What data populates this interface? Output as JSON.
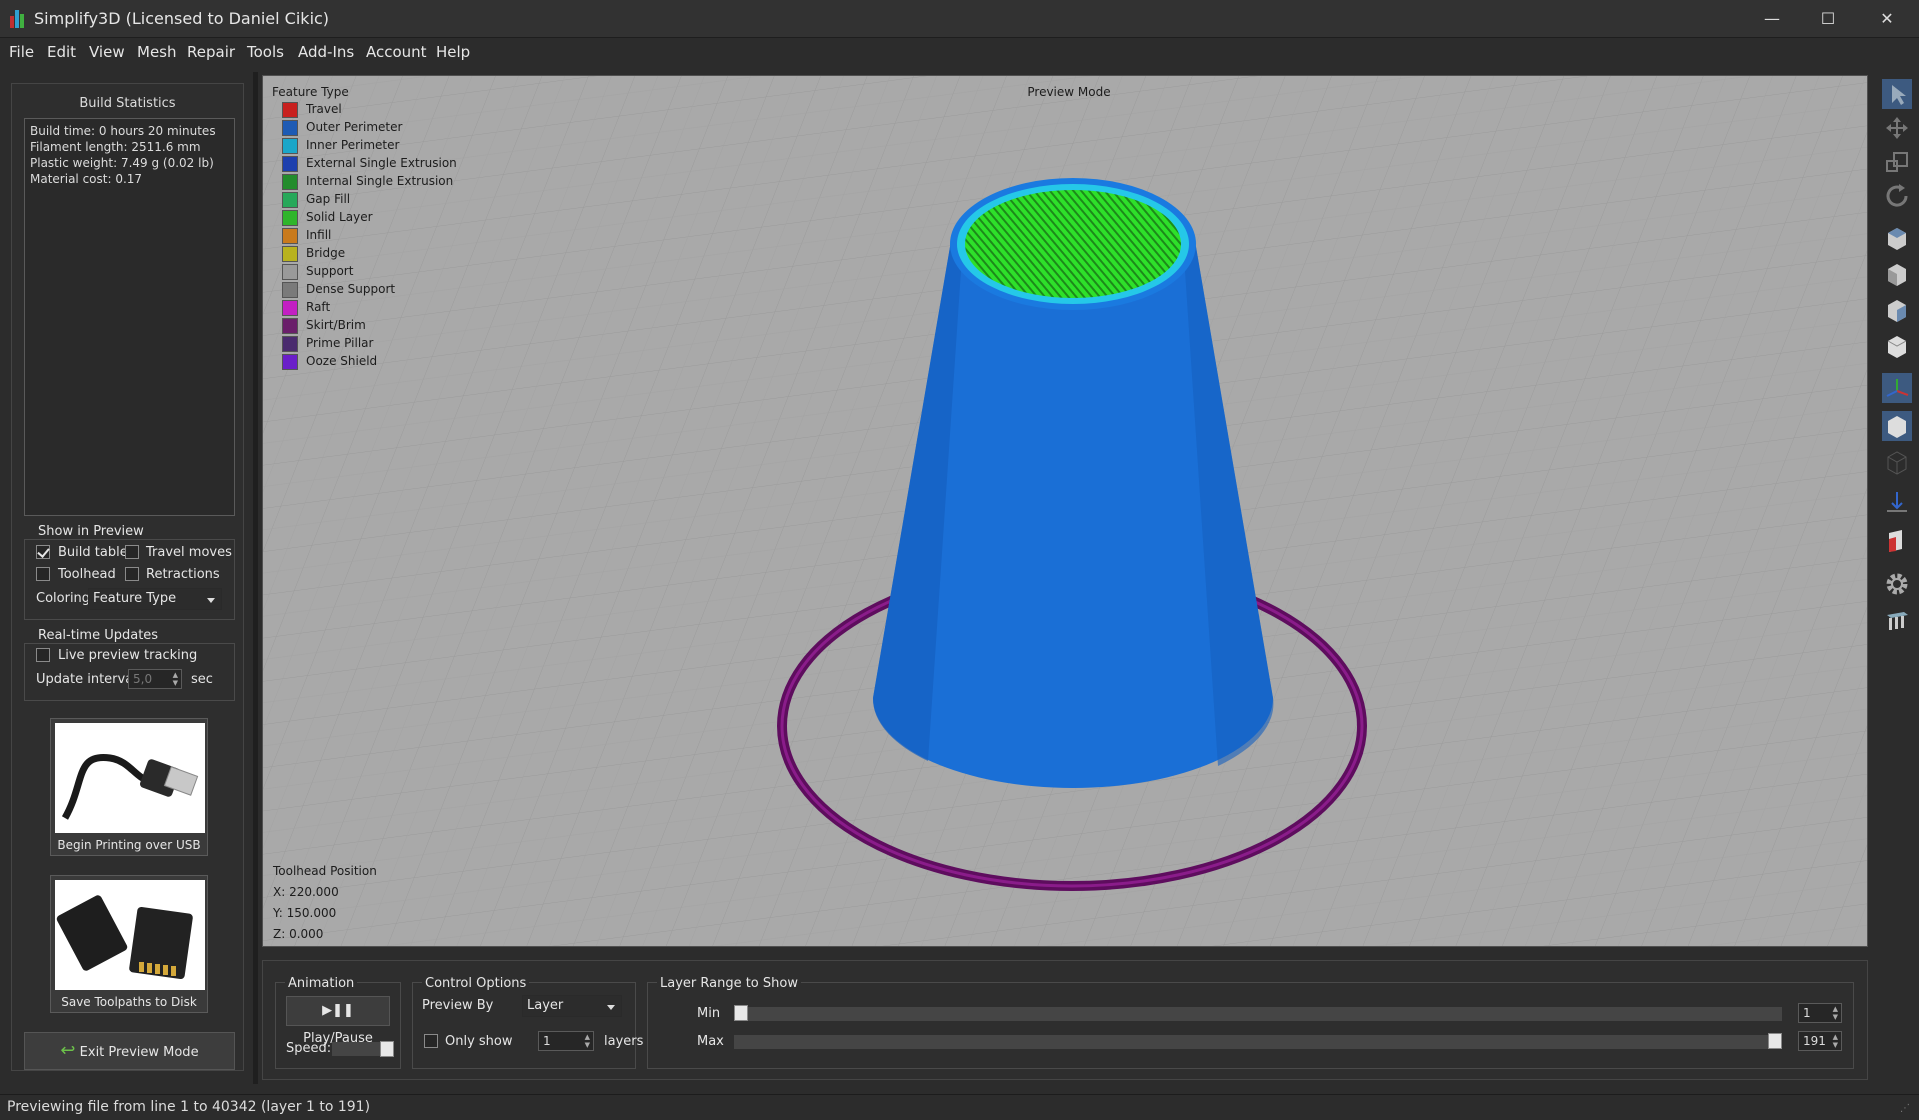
{
  "window": {
    "title": "Simplify3D (Licensed to Daniel Cikic)",
    "minimize": "—",
    "maximize": "☐",
    "close": "✕"
  },
  "menu": [
    "File",
    "Edit",
    "View",
    "Mesh",
    "Repair",
    "Tools",
    "Add-Ins",
    "Account",
    "Help"
  ],
  "build_stats": {
    "title": "Build Statistics",
    "lines": [
      "Build time: 0 hours 20 minutes",
      "Filament length: 2511.6 mm",
      "Plastic weight: 7.49 g (0.02 lb)",
      "Material cost: 0.17"
    ]
  },
  "show_in_preview": {
    "title": "Show in Preview",
    "build_table": {
      "label": "Build table",
      "checked": true
    },
    "travel_moves": {
      "label": "Travel moves",
      "checked": false
    },
    "toolhead": {
      "label": "Toolhead",
      "checked": false
    },
    "retractions": {
      "label": "Retractions",
      "checked": false
    },
    "coloring_label": "Coloring",
    "coloring_value": "Feature Type"
  },
  "realtime": {
    "title": "Real-time Updates",
    "live_label": "Live preview tracking",
    "interval_label": "Update interval",
    "interval_value": "5,0",
    "interval_unit": "sec"
  },
  "usb_button": {
    "label": "Begin Printing over USB"
  },
  "sd_button": {
    "label": "Save Toolpaths to Disk"
  },
  "exit_button": {
    "label": "Exit Preview Mode"
  },
  "viewport": {
    "mode_label": "Preview Mode",
    "legend_title": "Feature Type",
    "legend": [
      {
        "name": "Travel",
        "color": "#c8201e"
      },
      {
        "name": "Outer Perimeter",
        "color": "#1e5bb4"
      },
      {
        "name": "Inner Perimeter",
        "color": "#1aa6c9"
      },
      {
        "name": "External Single Extrusion",
        "color": "#1c3fae"
      },
      {
        "name": "Internal Single Extrusion",
        "color": "#238c2c"
      },
      {
        "name": "Gap Fill",
        "color": "#27a85a"
      },
      {
        "name": "Solid Layer",
        "color": "#2fb52a"
      },
      {
        "name": "Infill",
        "color": "#c97a1c"
      },
      {
        "name": "Bridge",
        "color": "#b8b21e"
      },
      {
        "name": "Support",
        "color": "#9a9a9a"
      },
      {
        "name": "Dense Support",
        "color": "#7a7a7a"
      },
      {
        "name": "Raft",
        "color": "#c21fc2"
      },
      {
        "name": "Skirt/Brim",
        "color": "#6a1e6a"
      },
      {
        "name": "Prime Pillar",
        "color": "#4a2a6e"
      },
      {
        "name": "Ooze Shield",
        "color": "#6a1ec8"
      }
    ],
    "toolhead_title": "Toolhead Position",
    "x": "X: 220.000",
    "y": "Y: 150.000",
    "z": "Z: 0.000",
    "model_color": "#1a6fd6",
    "top_fill_color": "#2ee02a",
    "skirt_color": "#6b0f6b"
  },
  "animation": {
    "title": "Animation",
    "play_label": "Play/Pause",
    "speed_label": "Speed:"
  },
  "control_options": {
    "title": "Control Options",
    "preview_by_label": "Preview By",
    "preview_by_value": "Layer",
    "only_show_label": "Only show",
    "only_show_value": "1",
    "layers_label": "layers"
  },
  "layer_range": {
    "title": "Layer Range to Show",
    "min_label": "Min",
    "max_label": "Max",
    "min_value": "1",
    "max_value": "191",
    "min_layer": 1,
    "max_layer": 191,
    "total_layers": 191
  },
  "status": "Previewing file from line 1 to 40342 (layer 1 to 191)",
  "toolbar_icons": [
    "select-icon",
    "move-icon",
    "scale-icon",
    "rotate-icon",
    "view-top-icon",
    "view-front-icon",
    "view-side-icon",
    "view-iso-icon",
    "axes-icon",
    "solid-view-icon",
    "wireframe-icon",
    "center-icon",
    "cross-section-icon",
    "settings-gear-icon",
    "bed-icon"
  ]
}
